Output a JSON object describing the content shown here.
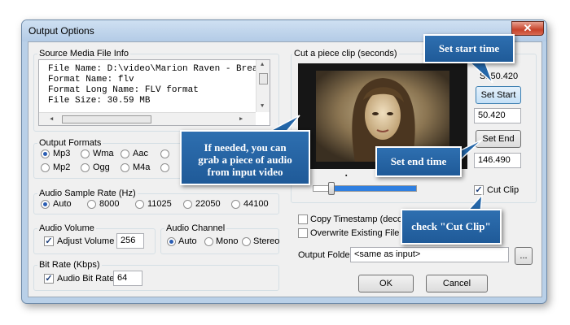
{
  "window": {
    "title": "Output Options",
    "close_glyph": "✕"
  },
  "source_info": {
    "label": "Source Media File Info",
    "lines": [
      "File Name: D:\\video\\Marion Raven - Brea",
      "Format Name: flv",
      "Format Long Name: FLV format",
      "File Size: 30.59 MB"
    ]
  },
  "output_formats": {
    "label": "Output Formats",
    "options": [
      "Mp3",
      "Wma",
      "Aac",
      "Mp2",
      "Ogg",
      "M4a"
    ],
    "selected": "Mp3"
  },
  "sample_rate": {
    "label": "Audio Sample Rate (Hz)",
    "options": [
      "Auto",
      "8000",
      "11025",
      "22050",
      "44100"
    ],
    "selected": "Auto"
  },
  "audio_volume": {
    "label": "Audio Volume",
    "adjust_label": "Adjust Volume",
    "value": "256",
    "checked": true
  },
  "audio_channel": {
    "label": "Audio Channel",
    "options": [
      "Auto",
      "Mono",
      "Stereo"
    ],
    "selected": "Auto"
  },
  "bit_rate": {
    "label": "Bit Rate (Kbps)",
    "enable_label": "Audio Bit Rate",
    "value": "64",
    "checked": true
  },
  "clip": {
    "label": "Cut a piece clip (seconds)",
    "start_prefix": "S: 50.420",
    "set_start_label": "Set Start",
    "start_value": "50.420",
    "set_end_label": "Set End",
    "end_value": "146.490",
    "cut_clip_label": "Cut Clip",
    "cut_clip_checked": true,
    "slider_position_fraction": 0.18
  },
  "options": {
    "copy_timestamp_label": "Copy Timestamp (decodin",
    "overwrite_label": "Overwrite Existing File"
  },
  "output_folder": {
    "label": "Output Folder",
    "value": "<same as input>",
    "browse_label": "..."
  },
  "buttons": {
    "ok_label": "OK",
    "cancel_label": "Cancel"
  },
  "callouts": {
    "set_start": "Set start time",
    "set_end": "Set end time",
    "grab_line1": "If needed, you can",
    "grab_line2": "grab a piece of audio",
    "grab_line3": "from input video",
    "cut_clip": "check \"Cut Clip\""
  },
  "colors": {
    "callout_blue": "#2466a8",
    "close_red": "#c7432b",
    "title_bar": "#c2d7ee"
  }
}
